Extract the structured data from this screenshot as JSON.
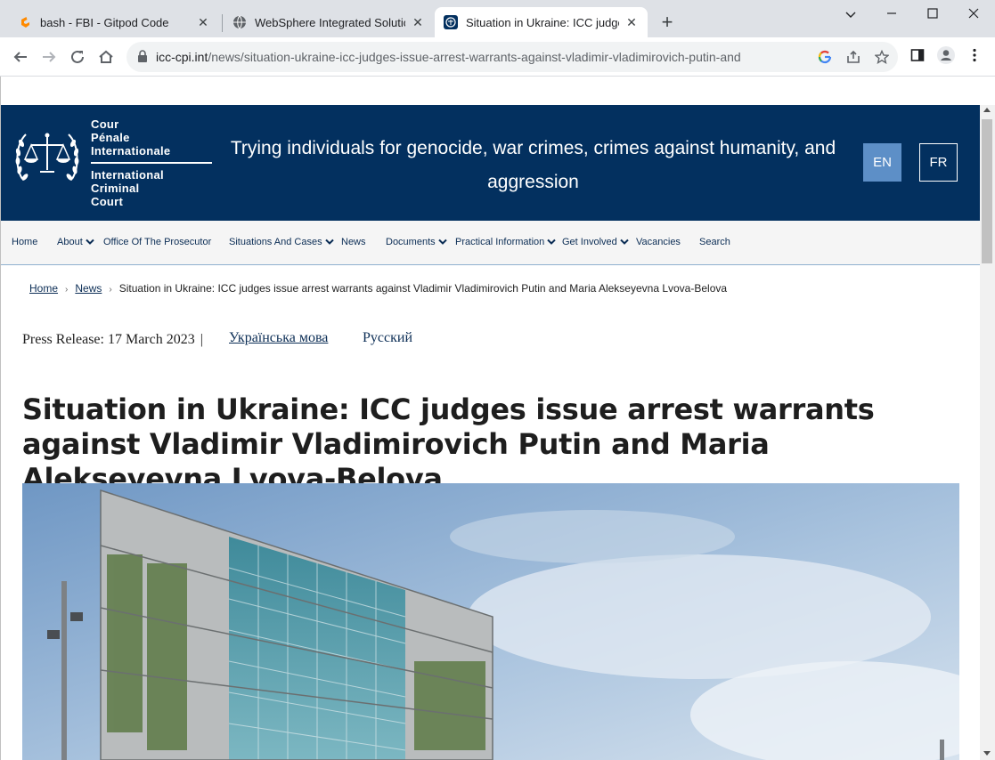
{
  "browser": {
    "tabs": [
      {
        "title": "bash - FBI - Gitpod Code",
        "icon": "gitpod-icon"
      },
      {
        "title": "WebSphere Integrated Solutions",
        "icon": "globe-icon"
      },
      {
        "title": "Situation in Ukraine: ICC judges",
        "icon": "icc-icon",
        "active": true
      }
    ],
    "url_host": "icc-cpi.int",
    "url_path": "/news/situation-ukraine-icc-judges-issue-arrest-warrants-against-vladimir-vladimirovich-putin-and"
  },
  "header": {
    "logo_fr": [
      "Cour",
      "Pénale",
      "Internationale"
    ],
    "logo_en": [
      "International",
      "Criminal",
      "Court"
    ],
    "tagline": "Trying individuals for genocide, war crimes, crimes against humanity, and aggression",
    "lang_en": "EN",
    "lang_fr": "FR",
    "brand_color": "#03305f",
    "active_lang_color": "#5d8fc7"
  },
  "nav": {
    "items": [
      {
        "label": "Home",
        "dropdown": false
      },
      {
        "label": "About",
        "dropdown": true
      },
      {
        "label": "Office Of The Prosecutor",
        "dropdown": false
      },
      {
        "label": "Situations And Cases",
        "dropdown": true
      },
      {
        "label": "News",
        "dropdown": false
      },
      {
        "label": "Documents",
        "dropdown": true
      },
      {
        "label": "Practical Information",
        "dropdown": true
      },
      {
        "label": "Get Involved",
        "dropdown": true
      },
      {
        "label": "Vacancies",
        "dropdown": false
      },
      {
        "label": "Search",
        "dropdown": false
      }
    ]
  },
  "breadcrumb": {
    "home": "Home",
    "news": "News",
    "current": "Situation in Ukraine: ICC judges issue arrest warrants against Vladimir Vladimirovich Putin and Maria Alekseyevna Lvova-Belova"
  },
  "article": {
    "press_release": "Press Release: 17 March 2023",
    "pipe": "|",
    "lang_ukrainian": "Українська мова",
    "lang_russian": "Русский",
    "title": "Situation in Ukraine: ICC judges issue arrest warrants against Vladimir Vladimirovich Putin and Maria Alekseyevna Lvova-Belova"
  }
}
